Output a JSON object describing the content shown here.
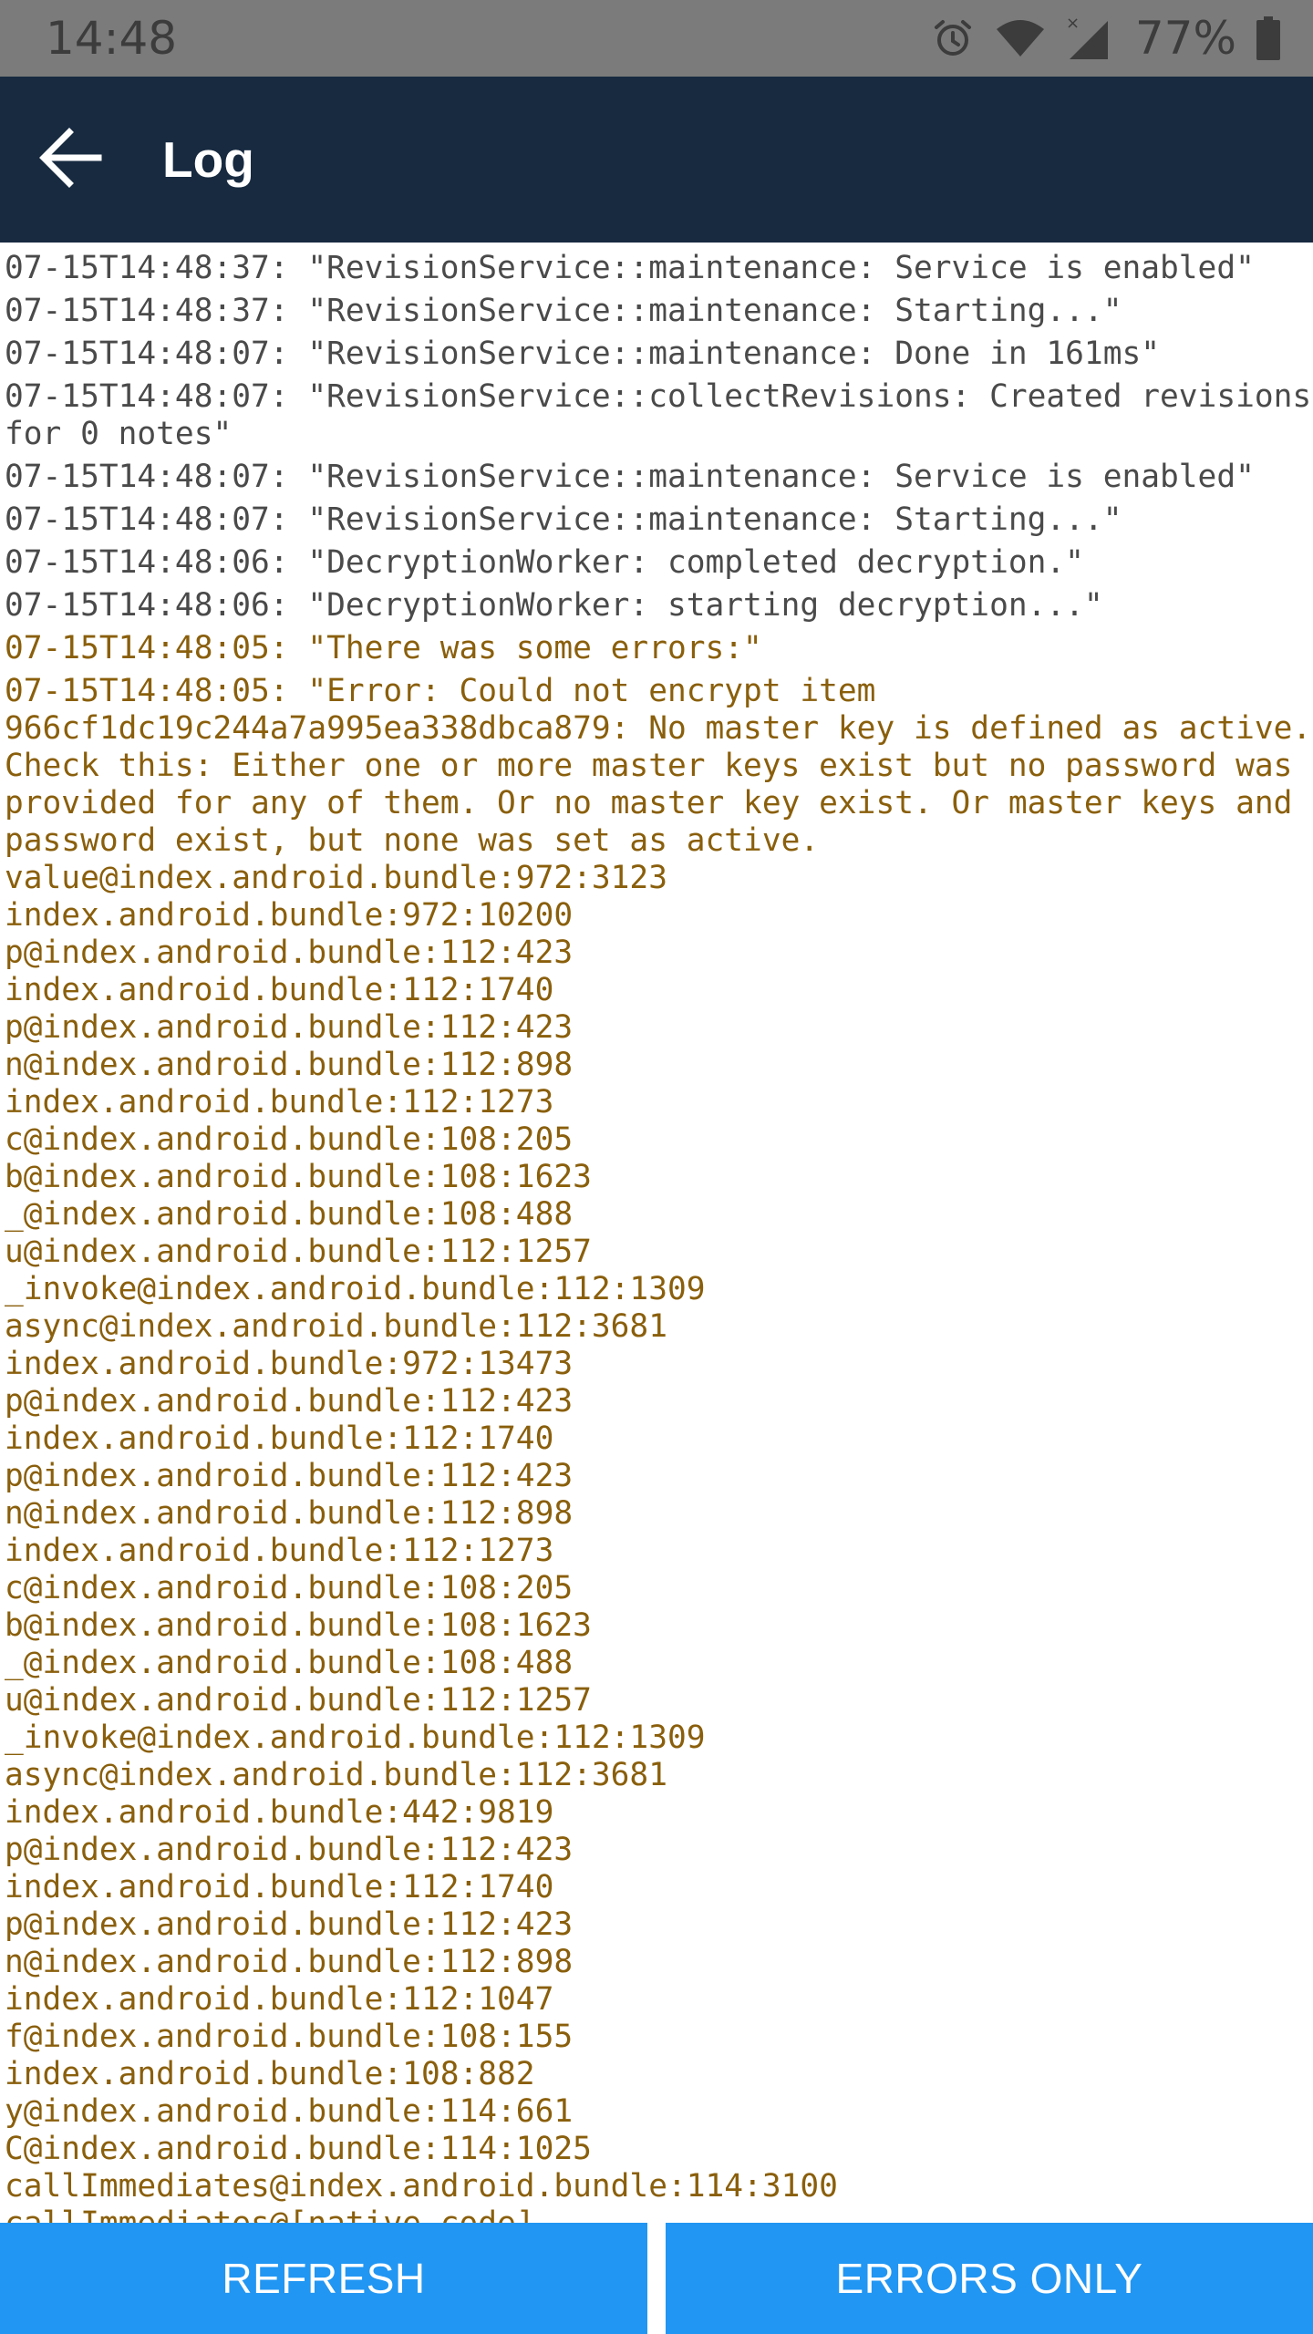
{
  "status_bar": {
    "time": "14:48",
    "battery": "77%",
    "icons": [
      "alarm-icon",
      "wifi-icon",
      "cellular-no-data-icon",
      "battery-icon"
    ]
  },
  "header": {
    "title": "Log",
    "back_icon": "arrow-back-icon"
  },
  "colors": {
    "header_bg": "#172a40",
    "button_bg": "#2196f3",
    "info_text": "#4a4a4a",
    "error_text": "#8a5f0c"
  },
  "log": [
    {
      "level": "info",
      "text": "07-15T14:48:37: \"RevisionService::maintenance: Service is enabled\""
    },
    {
      "level": "info",
      "text": "07-15T14:48:37: \"RevisionService::maintenance: Starting...\""
    },
    {
      "level": "info",
      "text": "07-15T14:48:07: \"RevisionService::maintenance: Done in 161ms\""
    },
    {
      "level": "info",
      "text": "07-15T14:48:07: \"RevisionService::collectRevisions: Created revisions for 0 notes\""
    },
    {
      "level": "info",
      "text": "07-15T14:48:07: \"RevisionService::maintenance: Service is enabled\""
    },
    {
      "level": "info",
      "text": "07-15T14:48:07: \"RevisionService::maintenance: Starting...\""
    },
    {
      "level": "info",
      "text": "07-15T14:48:06: \"DecryptionWorker: completed decryption.\""
    },
    {
      "level": "info",
      "text": "07-15T14:48:06: \"DecryptionWorker: starting decryption...\""
    },
    {
      "level": "error",
      "text": "07-15T14:48:05: \"There was some errors:\""
    },
    {
      "level": "error",
      "text": "07-15T14:48:05: \"Error: Could not encrypt item 966cf1dc19c244a7a995ea338dbca879: No master key is defined as active. Check this: Either one or more master keys exist but no password was provided for any of them. Or no master key exist. Or master keys and password exist, but none was set as active.\nvalue@index.android.bundle:972:3123\nindex.android.bundle:972:10200\np@index.android.bundle:112:423\nindex.android.bundle:112:1740\np@index.android.bundle:112:423\nn@index.android.bundle:112:898\nindex.android.bundle:112:1273\nc@index.android.bundle:108:205\nb@index.android.bundle:108:1623\n_@index.android.bundle:108:488\nu@index.android.bundle:112:1257\n_invoke@index.android.bundle:112:1309\nasync@index.android.bundle:112:3681\nindex.android.bundle:972:13473\np@index.android.bundle:112:423\nindex.android.bundle:112:1740\np@index.android.bundle:112:423\nn@index.android.bundle:112:898\nindex.android.bundle:112:1273\nc@index.android.bundle:108:205\nb@index.android.bundle:108:1623\n_@index.android.bundle:108:488\nu@index.android.bundle:112:1257\n_invoke@index.android.bundle:112:1309\nasync@index.android.bundle:112:3681\nindex.android.bundle:442:9819\np@index.android.bundle:112:423\nindex.android.bundle:112:1740\np@index.android.bundle:112:423\nn@index.android.bundle:112:898\nindex.android.bundle:112:1047\nf@index.android.bundle:108:155\nindex.android.bundle:108:882\ny@index.android.bundle:114:661\nC@index.android.bundle:114:1025\ncallImmediates@index.android.bundle:114:3100\ncallImmediates@[native code]"
    }
  ],
  "footer": {
    "refresh_label": "REFRESH",
    "errors_only_label": "ERRORS ONLY"
  }
}
